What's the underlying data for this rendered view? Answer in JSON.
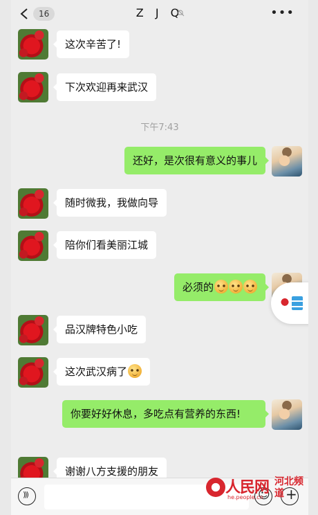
{
  "header": {
    "unread_count": "16",
    "title": "Z J Q",
    "more_label": "•••"
  },
  "messages": [
    {
      "side": "left",
      "text": "这次辛苦了!"
    },
    {
      "side": "left",
      "text": "下次欢迎再来武汉"
    },
    {
      "timestamp": "下午7:43"
    },
    {
      "side": "right",
      "text": "还好，是次很有意义的事儿"
    },
    {
      "side": "left",
      "text": "随时微我，我做向导"
    },
    {
      "side": "left",
      "text": "陪你们看美丽江城"
    },
    {
      "side": "right",
      "text": "必须的",
      "emojis": 3
    },
    {
      "side": "left",
      "text": "品汉牌特色小吃"
    },
    {
      "side": "left",
      "text": "这次武汉病了",
      "emojis": 1
    },
    {
      "side": "right",
      "text": "你要好好休息，多吃点有营养的东西!"
    },
    {
      "side": "left",
      "text": "谢谢八方支援的朋友"
    }
  ],
  "input": {
    "value": ""
  },
  "watermark": {
    "brand": "人民网",
    "region": "河北频道",
    "url": "he.people.cn"
  },
  "colors": {
    "chat_background": "#ededed",
    "sent_bubble": "#95ec69",
    "received_bubble": "#ffffff",
    "brand_red": "#d8262e"
  },
  "icons": [
    "back-chevron-icon",
    "mute-icon",
    "more-icon",
    "voice-icon",
    "emoji-icon",
    "plus-icon"
  ]
}
